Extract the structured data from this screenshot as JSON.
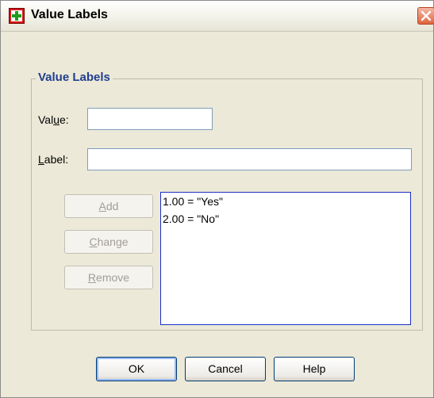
{
  "window": {
    "title": "Value Labels",
    "icon": "spss-dialog-icon",
    "close_icon": "close-icon"
  },
  "group": {
    "legend": "Value Labels"
  },
  "value_field": {
    "label_prefix": "Val",
    "label_mnemonic": "u",
    "label_suffix": "e:",
    "value": ""
  },
  "label_field": {
    "label_mnemonic": "L",
    "label_suffix": "abel:",
    "value": ""
  },
  "side_buttons": {
    "add_mnemonic": "A",
    "add_rest": "dd",
    "change_mnemonic": "C",
    "change_rest": "hange",
    "remove_mnemonic": "R",
    "remove_rest": "emove"
  },
  "labels_list": {
    "items": [
      "1.00 = \"Yes\"",
      "2.00 = \"No\""
    ]
  },
  "footer": {
    "ok_label": "OK",
    "cancel_label": "Cancel",
    "help_label": "Help"
  },
  "colors": {
    "legend": "#1f3f8f",
    "dialog_bg": "#ece9d8",
    "listbox_border": "#1b2fc7",
    "disabled_text": "#a19f94"
  }
}
